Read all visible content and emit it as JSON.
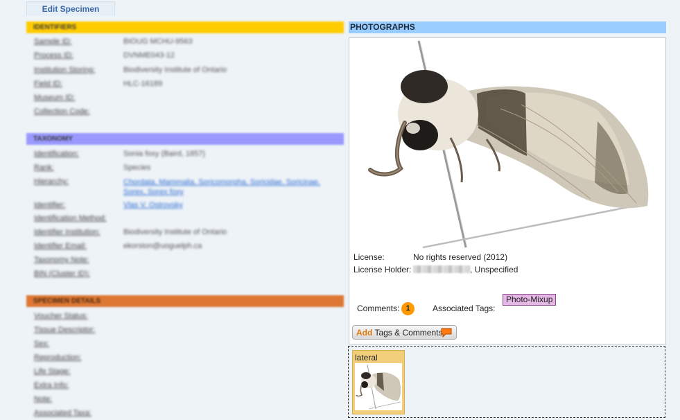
{
  "tab": {
    "label": "Edit Specimen"
  },
  "sections": {
    "identifiers": {
      "title": "IDENTIFIERS",
      "rows": [
        {
          "label": "Sample ID:",
          "value": "BIOUG MCHU-9563"
        },
        {
          "label": "Process ID:",
          "value": "DVNME043-12"
        },
        {
          "label": "Institution Storing:",
          "value": "Biodiversity Institute of Ontario"
        },
        {
          "label": "Field ID:",
          "value": "HLC-16189"
        },
        {
          "label": "Museum ID:",
          "value": ""
        },
        {
          "label": "Collection Code:",
          "value": ""
        }
      ]
    },
    "taxonomy": {
      "title": "TAXONOMY",
      "rows": [
        {
          "label": "Identification:",
          "value": "Sonia foxy (Baird, 1857)"
        },
        {
          "label": "Rank:",
          "value": "Species"
        },
        {
          "label": "Hierarchy:",
          "value": "Chordata, Mammalia, Soricomorpha, Soricidae, Soricinae, Sorex, Sorex foxy"
        },
        {
          "label": "Identifier:",
          "value": "Vlas V. Ostrovsky"
        },
        {
          "label": "Identification Method:",
          "value": ""
        },
        {
          "label": "Identifier Institution:",
          "value": "Biodiversity Institute of Ontario"
        },
        {
          "label": "Identifier Email:",
          "value": "ekorston@uoguelph.ca"
        },
        {
          "label": "Taxonomy Note:",
          "value": ""
        },
        {
          "label": "BIN (Cluster ID):",
          "value": ""
        }
      ]
    },
    "specimen_details": {
      "title": "SPECIMEN DETAILS",
      "rows": [
        {
          "label": "Voucher Status:",
          "value": ""
        },
        {
          "label": "Tissue Descriptor:",
          "value": ""
        },
        {
          "label": "Sex:",
          "value": ""
        },
        {
          "label": "Reproduction:",
          "value": ""
        },
        {
          "label": "Life Stage:",
          "value": ""
        },
        {
          "label": "Extra Info:",
          "value": ""
        },
        {
          "label": "Note:",
          "value": ""
        },
        {
          "label": "Associated Taxa:",
          "value": ""
        }
      ]
    }
  },
  "photographs": {
    "title": "PHOTOGRAPHS",
    "license_label": "License:",
    "license_value": "No rights reserved (2012)",
    "holder_label": "License Holder:",
    "holder_suffix": ", Unspecified",
    "comments_label": "Comments:",
    "comments_count": "1",
    "tags_label": "Associated Tags:",
    "tag": "Photo-Mixup",
    "add_word": "Add",
    "add_rest": " Tags & Comments",
    "thumbnail_label": "lateral"
  },
  "colors": {
    "identifiers_header": "#ffcc00",
    "taxonomy_header": "#9999ff",
    "specimen_header": "#dd7733",
    "photographs_header": "#99ccff",
    "comment_badge": "#ff9900",
    "tag_badge": "#e4b7e4",
    "thumbnail_card": "#f1cf7a"
  },
  "icons": {
    "comment": "speech-bubble-icon"
  }
}
